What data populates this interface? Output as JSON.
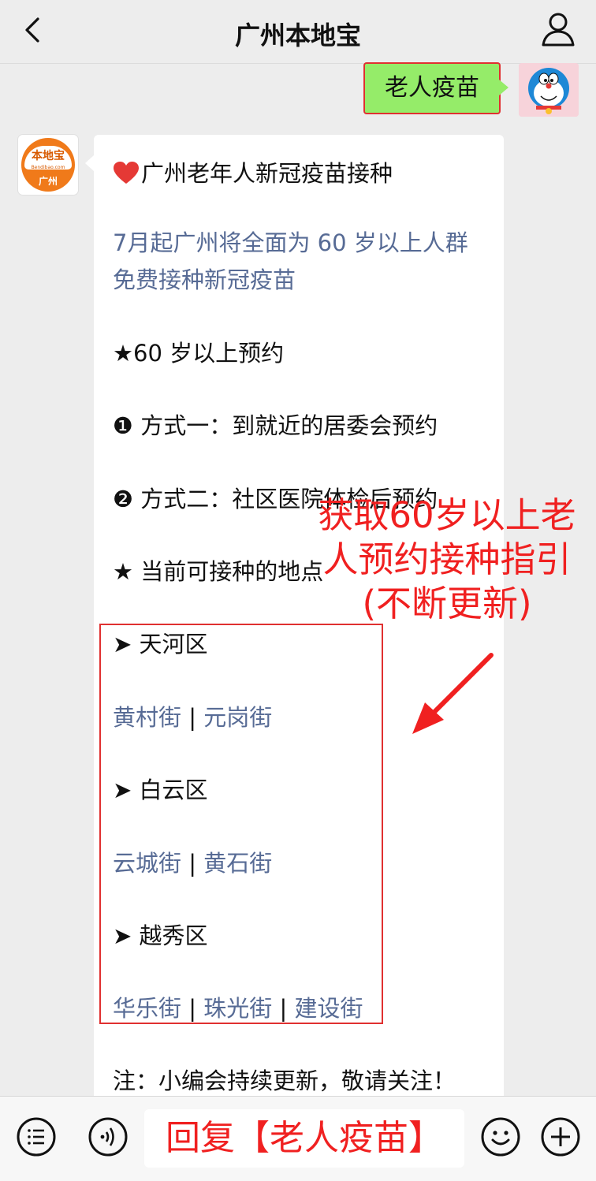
{
  "header": {
    "title": "广州本地宝"
  },
  "outgoing": {
    "text": "老人疫苗"
  },
  "bot": {
    "logo_top": "本地宝",
    "logo_small": "Bendibao.com",
    "logo_city": "广州"
  },
  "message": {
    "heading": "广州老年人新冠疫苗接种",
    "link_line1": "7月起广州将全面为 60 岁以上人群",
    "link_line2": "免费接种新冠疫苗",
    "section1": "★60 岁以上预约",
    "method1_num": "❶",
    "method1": "方式一：到就近的居委会预约",
    "method2_num": "❷",
    "method2": "方式二：社区医院体检后预约",
    "section2": "★ 当前可接种的地点",
    "marker": "➤",
    "sep": " | ",
    "districts": [
      {
        "name": "天河区",
        "streets": [
          "黄村街",
          "元岗街"
        ]
      },
      {
        "name": "白云区",
        "streets": [
          "云城街",
          "黄石街"
        ]
      },
      {
        "name": "越秀区",
        "streets": [
          "华乐街",
          "珠光街",
          "建设街"
        ]
      }
    ],
    "note": "注：小编会持续更新，敬请关注！"
  },
  "annotation": {
    "line1": "获取60岁以上老",
    "line2": "人预约接种指引",
    "line3": "(不断更新)"
  },
  "input": {
    "text": "回复【老人疫苗】"
  },
  "colors": {
    "link": "#576b95",
    "outgoing_bubble": "#95ec69",
    "annotation": "#f02020"
  }
}
